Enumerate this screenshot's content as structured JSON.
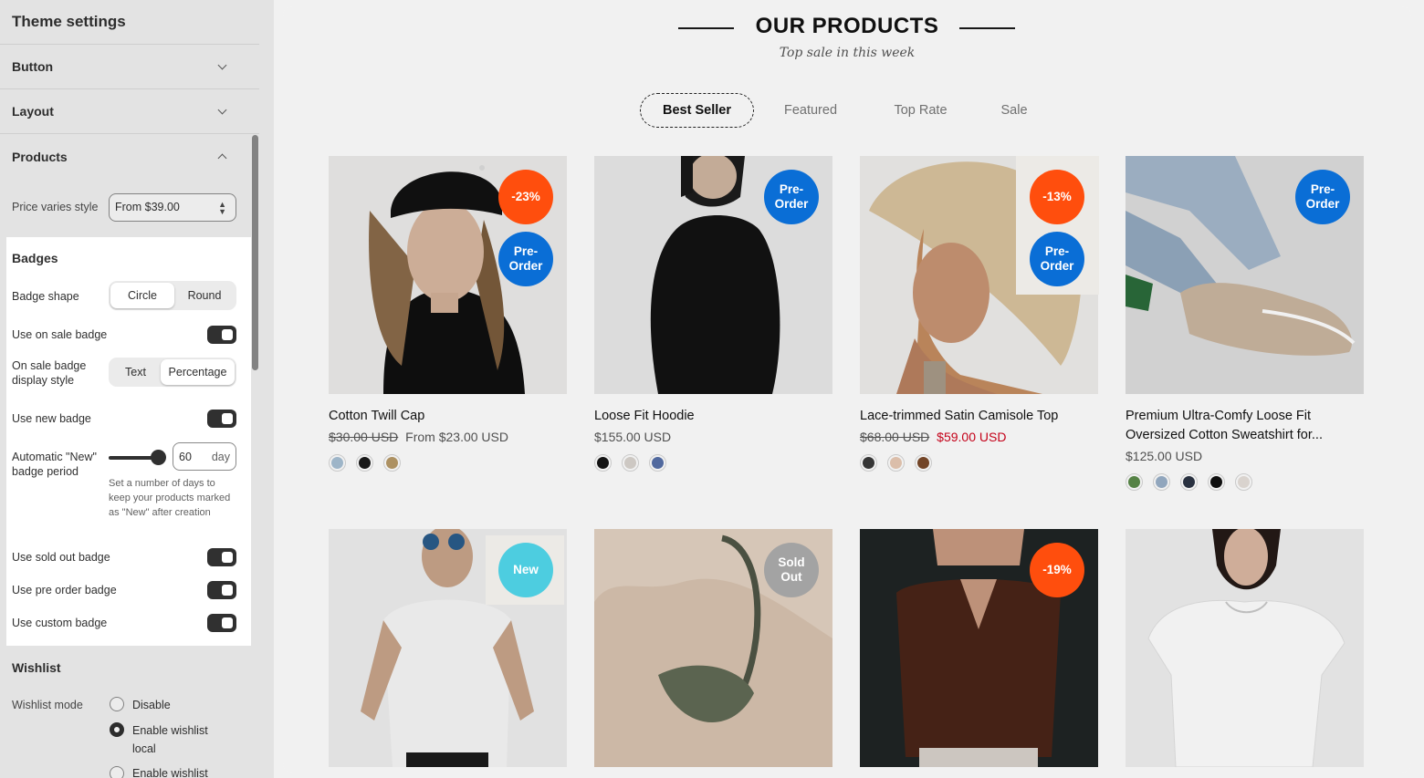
{
  "sidebar": {
    "title": "Theme settings",
    "sections": [
      {
        "label": "Button"
      },
      {
        "label": "Layout"
      },
      {
        "label": "Products"
      }
    ],
    "price_varies_label": "Price varies style",
    "price_varies_value": "From $39.00",
    "badges": {
      "heading": "Badges",
      "shape_label": "Badge shape",
      "shape_options": [
        "Circle",
        "Round"
      ],
      "use_sale_label": "Use on sale badge",
      "sale_style_label": "On sale badge display style",
      "sale_style_options": [
        "Text",
        "Percentage"
      ],
      "use_new_label": "Use new badge",
      "auto_new_label": "Automatic \"New\" badge period",
      "auto_new_value": "60",
      "auto_new_suffix": "day",
      "auto_new_help": "Set a number of days to keep your products marked as \"New\" after creation",
      "use_soldout_label": "Use sold out badge",
      "use_preorder_label": "Use pre order badge",
      "use_custom_label": "Use custom badge"
    },
    "wishlist": {
      "heading": "Wishlist",
      "mode_label": "Wishlist mode",
      "options": [
        "Disable",
        "Enable wishlist local",
        "Enable wishlist"
      ]
    }
  },
  "preview": {
    "title": "OUR PRODUCTS",
    "subtitle": "Top sale in this week",
    "tabs": [
      "Best Seller",
      "Featured",
      "Top Rate",
      "Sale"
    ],
    "products": [
      {
        "name": "Cotton Twill Cap",
        "old_price": "$30.00 USD",
        "price": "From $23.00 USD",
        "badges": [
          "-23%",
          "Pre-\nOrder"
        ]
      },
      {
        "name": "Loose Fit Hoodie",
        "price": "$155.00 USD",
        "badges": [
          "Pre-\nOrder"
        ]
      },
      {
        "name": "Lace-trimmed Satin Camisole Top",
        "old_price": "$68.00 USD",
        "sale_price": "$59.00 USD",
        "badges": [
          "-13%",
          "Pre-\nOrder"
        ]
      },
      {
        "name": "Premium Ultra-Comfy Loose Fit Oversized Cotton Sweatshirt for...",
        "price": "$125.00 USD",
        "badges": [
          "Pre-\nOrder"
        ]
      },
      {
        "badges": [
          "New"
        ]
      },
      {
        "badges": [
          "Sold\nOut"
        ]
      },
      {
        "badges": [
          "-19%"
        ]
      },
      {
        "badges": []
      }
    ]
  },
  "colors": {
    "sale_badge": "#ff4e0d",
    "preorder_badge": "#0a6ed6",
    "new_badge": "#4dcde0",
    "soldout_badge": "#a3a3a3",
    "sale_price": "#d0021b"
  }
}
